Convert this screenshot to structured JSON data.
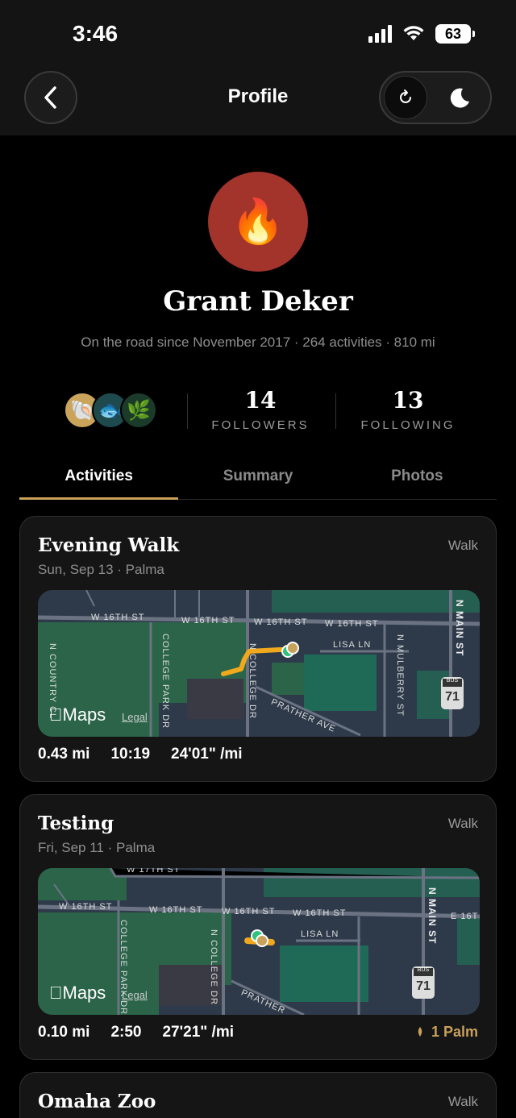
{
  "status": {
    "time": "3:46",
    "battery": "63"
  },
  "header": {
    "title": "Profile"
  },
  "profile": {
    "name": "Grant Deker",
    "subline": "On the road since November 2017 · 264 activities · 810 mi",
    "avatar_emoji": "🔥",
    "badges": [
      "🐚",
      "🐟",
      "🌿"
    ],
    "followers_count": "14",
    "followers_label": "FOLLOWERS",
    "following_count": "13",
    "following_label": "FOLLOWING"
  },
  "tabs": [
    {
      "label": "Activities",
      "active": true
    },
    {
      "label": "Summary",
      "active": false
    },
    {
      "label": "Photos",
      "active": false
    }
  ],
  "activities": [
    {
      "title": "Evening Walk",
      "subtitle": "Sun, Sep 13 · Palma",
      "type": "Walk",
      "distance": "0.43 mi",
      "duration": "10:19",
      "pace": "24'01\" /mi",
      "map": {
        "logo": "Maps",
        "legal": "Legal",
        "streets": [
          "W 16TH ST",
          "W 16TH ST",
          "W 16TH ST",
          "W 16TH ST",
          "LISA LN",
          "COLLEGE PARK DR",
          "N COLLEGE DR",
          "PRATHER AVE",
          "N MULBERRY ST",
          "N MAIN ST",
          "N COUNTRY CL"
        ],
        "shield": "71",
        "shield_label": "BUS"
      }
    },
    {
      "title": "Testing",
      "subtitle": "Fri, Sep 11 · Palma",
      "type": "Walk",
      "distance": "0.10 mi",
      "duration": "2:50",
      "pace": "27'21\" /mi",
      "palm": "1 Palm",
      "map": {
        "logo": "Maps",
        "legal": "Legal",
        "streets": [
          "W 17TH ST",
          "W 16TH ST",
          "W 16TH ST",
          "W 16TH ST",
          "W 16TH ST",
          "LISA LN",
          "COLLEGE PARK DR",
          "N COLLEGE DR",
          "PRATHER",
          "N MAIN ST",
          "E 16T"
        ],
        "shield": "71",
        "shield_label": "BUS"
      }
    },
    {
      "title": "Omaha Zoo",
      "type": "Walk"
    }
  ],
  "colors": {
    "accent": "#c8a15a",
    "avatar_bg": "#a2342b",
    "route": "#f0a81c"
  }
}
